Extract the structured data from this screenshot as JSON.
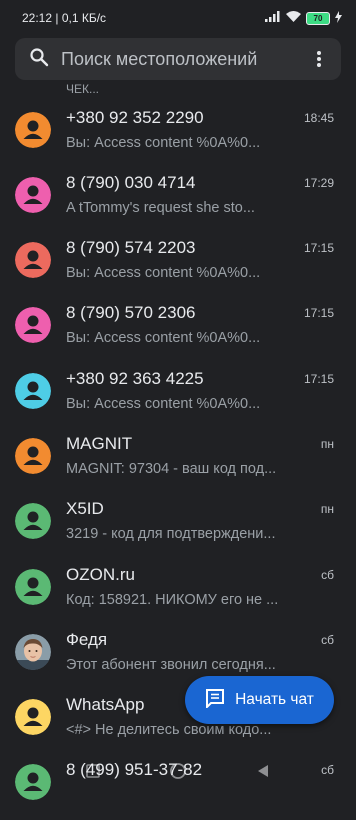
{
  "status_bar": {
    "time": "22:12",
    "speed": "0,1 КБ/с",
    "battery": "70"
  },
  "search": {
    "placeholder": "Поиск местоположений"
  },
  "partial_row_text": "ЧЕК...",
  "conversations": [
    {
      "name": "+380 92 352 2290",
      "preview": "Вы: Access content  %0A%0...",
      "time": "18:45",
      "avatar_color": "#f28b30"
    },
    {
      "name": "8 (790) 030 4714",
      "preview": "A tTommy's request she sto...",
      "time": "17:29",
      "avatar_color": "#ee5fae"
    },
    {
      "name": "8 (790) 574 2203",
      "preview": "Вы: Access content  %0A%0...",
      "time": "17:15",
      "avatar_color": "#ec6a5e"
    },
    {
      "name": "8 (790) 570 2306",
      "preview": "Вы: Access content  %0A%0...",
      "time": "17:15",
      "avatar_color": "#ee5fae"
    },
    {
      "name": "+380 92 363 4225",
      "preview": "Вы: Access content  %0A%0...",
      "time": "17:15",
      "avatar_color": "#4ecde6"
    },
    {
      "name": "MAGNIT",
      "preview": "MAGNIT: 97304 - ваш код под...",
      "time": "пн",
      "avatar_color": "#f28b30"
    },
    {
      "name": "X5ID",
      "preview": "3219 - код для подтверждени...",
      "time": "пн",
      "avatar_color": "#5bb974"
    },
    {
      "name": "OZON.ru",
      "preview": "Код: 158921. НИКОМУ его не ...",
      "time": "сб",
      "avatar_color": "#5bb974"
    },
    {
      "name": "Федя",
      "preview": "Этот абонент звонил сегодня...",
      "time": "сб",
      "avatar_color": "photo"
    },
    {
      "name": "WhatsApp",
      "preview": "<#> Не делитесь своим кодо...",
      "time": "",
      "avatar_color": "#fdd663"
    },
    {
      "name": "8 (499) 951-37-82",
      "preview": "",
      "time": "сб",
      "avatar_color": "#5bb974"
    }
  ],
  "fab": {
    "label": "Начать чат"
  }
}
